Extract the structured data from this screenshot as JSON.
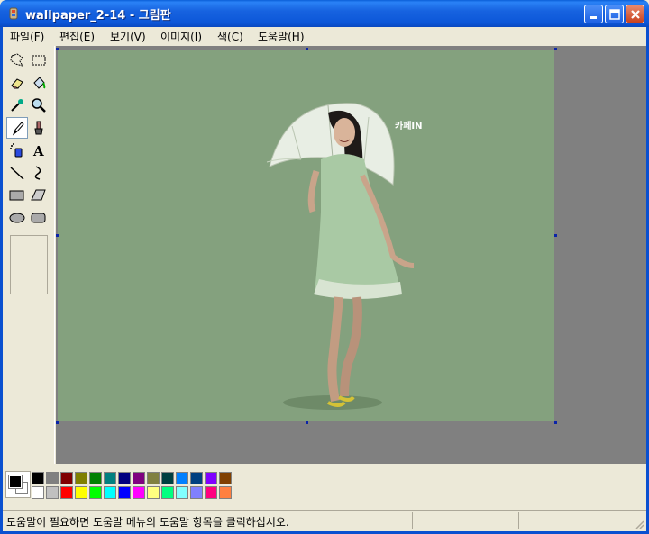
{
  "window": {
    "title": "wallpaper_2-14 - 그림판",
    "buttons": {
      "minimize": "minimize-icon",
      "maximize": "maximize-icon",
      "close": "close-icon"
    }
  },
  "menu": {
    "items": [
      {
        "label": "파일(F)"
      },
      {
        "label": "편집(E)"
      },
      {
        "label": "보기(V)"
      },
      {
        "label": "이미지(I)"
      },
      {
        "label": "색(C)"
      },
      {
        "label": "도움말(H)"
      }
    ]
  },
  "tools": [
    {
      "name": "free-select-icon"
    },
    {
      "name": "rect-select-icon"
    },
    {
      "name": "eraser-icon"
    },
    {
      "name": "fill-bucket-icon"
    },
    {
      "name": "color-picker-icon"
    },
    {
      "name": "magnifier-icon"
    },
    {
      "name": "pencil-icon",
      "selected": true
    },
    {
      "name": "brush-icon"
    },
    {
      "name": "airbrush-icon"
    },
    {
      "name": "text-icon",
      "glyph": "A"
    },
    {
      "name": "line-icon"
    },
    {
      "name": "curve-icon"
    },
    {
      "name": "rectangle-icon"
    },
    {
      "name": "polygon-icon"
    },
    {
      "name": "ellipse-icon"
    },
    {
      "name": "rounded-rect-icon"
    }
  ],
  "canvas": {
    "background_color": "#84a17e",
    "image_caption": "",
    "watermark": "카페IN"
  },
  "palette": {
    "foreground": "#000000",
    "background": "#ffffff",
    "top_row": [
      "#000000",
      "#808080",
      "#800000",
      "#808000",
      "#008000",
      "#008080",
      "#000080",
      "#800080",
      "#808040",
      "#004040",
      "#0080ff",
      "#004080",
      "#8000ff",
      "#804000"
    ],
    "bottom_row": [
      "#ffffff",
      "#c0c0c0",
      "#ff0000",
      "#ffff00",
      "#00ff00",
      "#00ffff",
      "#0000ff",
      "#ff00ff",
      "#ffff80",
      "#00ff80",
      "#80ffff",
      "#8080ff",
      "#ff0080",
      "#ff8040"
    ]
  },
  "status": {
    "text": "도움말이 필요하면 도움말 메뉴의 도움말 항목을 클릭하십시오."
  }
}
